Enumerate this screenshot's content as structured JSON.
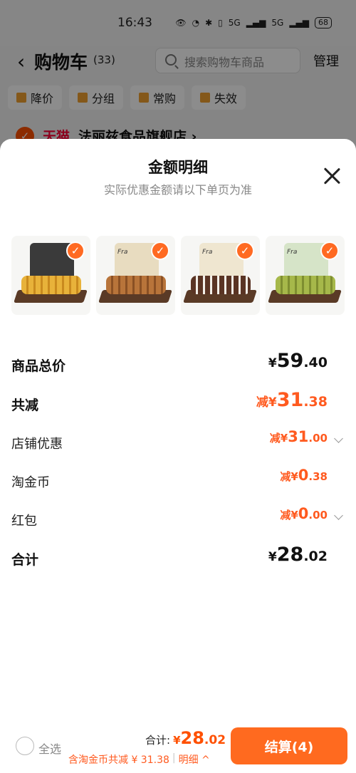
{
  "status_bar": {
    "time": "16:43",
    "signal1": "5G",
    "signal2": "5G",
    "battery": "68"
  },
  "header": {
    "title": "购物车",
    "count": "(33)",
    "search_placeholder": "搜索购物车商品",
    "manage": "管理"
  },
  "filters": [
    {
      "label": "降价",
      "icon": "price-down-icon"
    },
    {
      "label": "分组",
      "icon": "folder-icon"
    },
    {
      "label": "常购",
      "icon": "cart-icon"
    },
    {
      "label": "失效",
      "icon": "expired-icon"
    }
  ],
  "shop": {
    "platform": "天猫",
    "name": "法丽兹食品旗舰店 ›"
  },
  "sheet": {
    "title": "金额明细",
    "subtitle": "实际优惠金额请以下单页为准",
    "thumbnails": [
      {
        "brand": "",
        "bag": "#3a3a3a",
        "c1": "#e8b23a",
        "c2": "#c98a1e"
      },
      {
        "brand": "Fra",
        "bag": "#e8dcc0",
        "c1": "#b8743a",
        "c2": "#8a5024"
      },
      {
        "brand": "Fra",
        "bag": "#efe6d0",
        "c1": "#5a3424",
        "c2": "#f2efe8"
      },
      {
        "brand": "Fra",
        "bag": "#d6e4c8",
        "c1": "#a6b84a",
        "c2": "#7e8e30"
      }
    ],
    "rows": [
      {
        "label": "商品总价",
        "prefix": "¥",
        "int": "59",
        "dec": ".40"
      },
      {
        "label": "共减",
        "prefix": "减¥",
        "int": "31",
        "dec": ".38"
      },
      {
        "label": "店铺优惠",
        "prefix": "减¥",
        "int": "31",
        "dec": ".00"
      },
      {
        "label": "淘金币",
        "prefix": "减¥",
        "int": "0",
        "dec": ".38"
      },
      {
        "label": "红包",
        "prefix": "减¥",
        "int": "0",
        "dec": ".00"
      },
      {
        "label": "合计",
        "prefix": "¥",
        "int": "28",
        "dec": ".02"
      }
    ]
  },
  "bottom_bar": {
    "select_all": "全选",
    "total_label": "合计:",
    "total_prefix": "¥",
    "total_int": "28",
    "total_dec": ".02",
    "discount_text": "含淘金币共减 ¥ 31.38",
    "detail_label": "明细 ^",
    "checkout": "结算(4)"
  },
  "colors": {
    "accent": "#ff5a1f",
    "tmall": "#ff0036"
  }
}
